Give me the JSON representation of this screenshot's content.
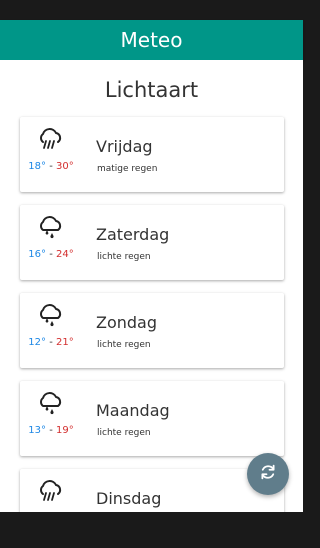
{
  "app": {
    "title": "Meteo"
  },
  "location": "Lichtaart",
  "forecast": [
    {
      "day": "Vrijdag",
      "description": "matige regen",
      "min": "18°",
      "max": "30°",
      "separator": "-",
      "icon": "rain-cloud-icon"
    },
    {
      "day": "Zaterdag",
      "description": "lichte regen",
      "min": "16°",
      "max": "24°",
      "separator": "-",
      "icon": "drizzle-cloud-icon"
    },
    {
      "day": "Zondag",
      "description": "lichte regen",
      "min": "12°",
      "max": "21°",
      "separator": "-",
      "icon": "drizzle-cloud-icon"
    },
    {
      "day": "Maandag",
      "description": "lichte regen",
      "min": "13°",
      "max": "19°",
      "separator": "-",
      "icon": "drizzle-cloud-icon"
    },
    {
      "day": "Dinsdag",
      "icon": "rain-cloud-icon"
    }
  ],
  "fab": {
    "icon": "refresh-icon"
  },
  "colors": {
    "appbar": "#009688",
    "fab": "#607d8b",
    "min_temp": "#1e88e5",
    "max_temp": "#d32f2f"
  }
}
